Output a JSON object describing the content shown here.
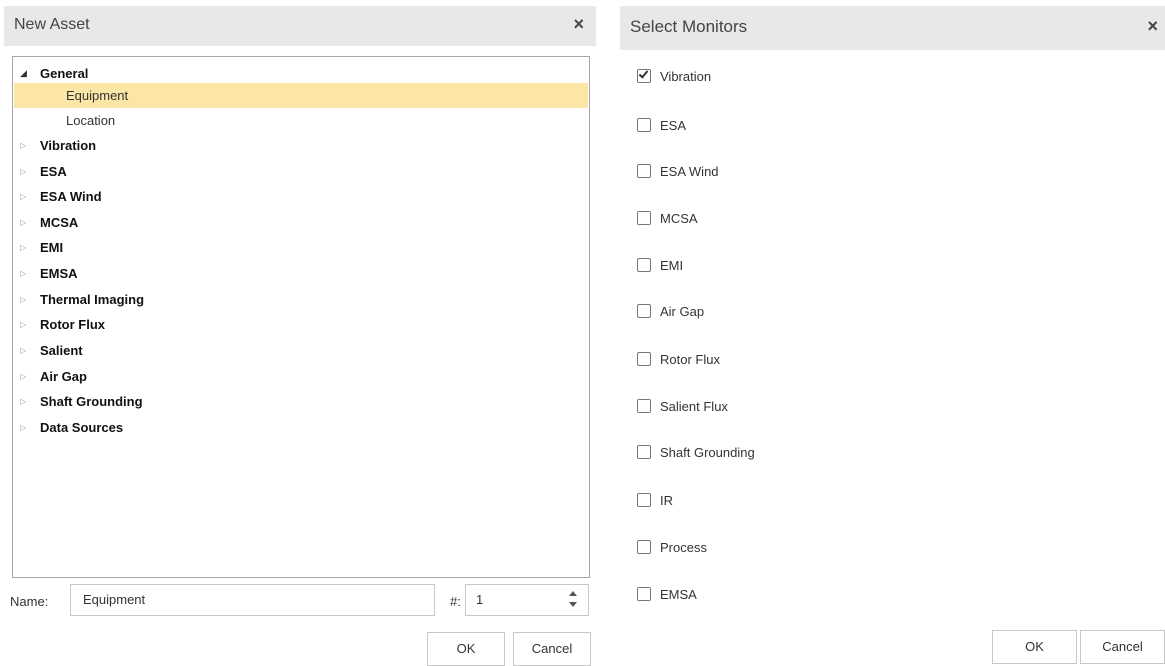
{
  "new_asset": {
    "title": "New Asset",
    "close_glyph": "×",
    "tree": [
      {
        "label": "General",
        "level": 0,
        "expanded": true
      },
      {
        "label": "Equipment",
        "level": 1,
        "selected": true
      },
      {
        "label": "Location",
        "level": 1
      },
      {
        "label": "Vibration",
        "level": 0
      },
      {
        "label": "ESA",
        "level": 0
      },
      {
        "label": "ESA Wind",
        "level": 0
      },
      {
        "label": "MCSA",
        "level": 0
      },
      {
        "label": "EMI",
        "level": 0
      },
      {
        "label": "EMSA",
        "level": 0
      },
      {
        "label": "Thermal Imaging",
        "level": 0
      },
      {
        "label": "Rotor Flux",
        "level": 0
      },
      {
        "label": "Salient",
        "level": 0
      },
      {
        "label": "Air Gap",
        "level": 0
      },
      {
        "label": "Shaft Grounding",
        "level": 0
      },
      {
        "label": "Data Sources",
        "level": 0
      }
    ],
    "name_label": "Name:",
    "name_value": "Equipment",
    "number_label": "#:",
    "number_value": "1",
    "ok_label": "OK",
    "cancel_label": "Cancel"
  },
  "select_monitors": {
    "title": "Select Monitors",
    "close_glyph": "×",
    "monitors": [
      {
        "label": "Vibration",
        "checked": true
      },
      {
        "label": "ESA",
        "checked": false
      },
      {
        "label": "ESA Wind",
        "checked": false
      },
      {
        "label": "MCSA",
        "checked": false
      },
      {
        "label": "EMI",
        "checked": false
      },
      {
        "label": "Air Gap",
        "checked": false
      },
      {
        "label": "Rotor Flux",
        "checked": false
      },
      {
        "label": "Salient Flux",
        "checked": false
      },
      {
        "label": "Shaft Grounding",
        "checked": false
      },
      {
        "label": "IR",
        "checked": false
      },
      {
        "label": "Process",
        "checked": false
      },
      {
        "label": "EMSA",
        "checked": false
      }
    ],
    "ok_label": "OK",
    "cancel_label": "Cancel"
  },
  "colors": {
    "titlebar_bg": "#e8e8e8",
    "selected_row_bg": "#fbe6a6",
    "border": "#a6a6a6"
  }
}
